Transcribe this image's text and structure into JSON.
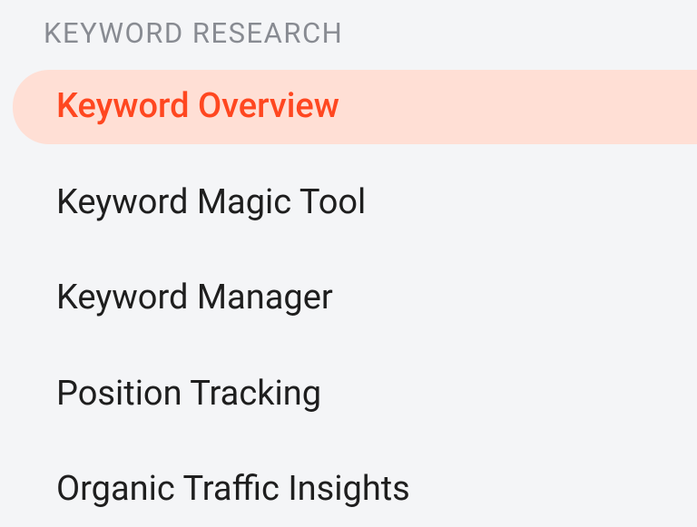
{
  "sidebar": {
    "section_header": "KEYWORD RESEARCH",
    "items": [
      {
        "label": "Keyword Overview",
        "active": true
      },
      {
        "label": "Keyword Magic Tool",
        "active": false
      },
      {
        "label": "Keyword Manager",
        "active": false
      },
      {
        "label": "Position Tracking",
        "active": false
      },
      {
        "label": "Organic Traffic Insights",
        "active": false
      }
    ]
  }
}
